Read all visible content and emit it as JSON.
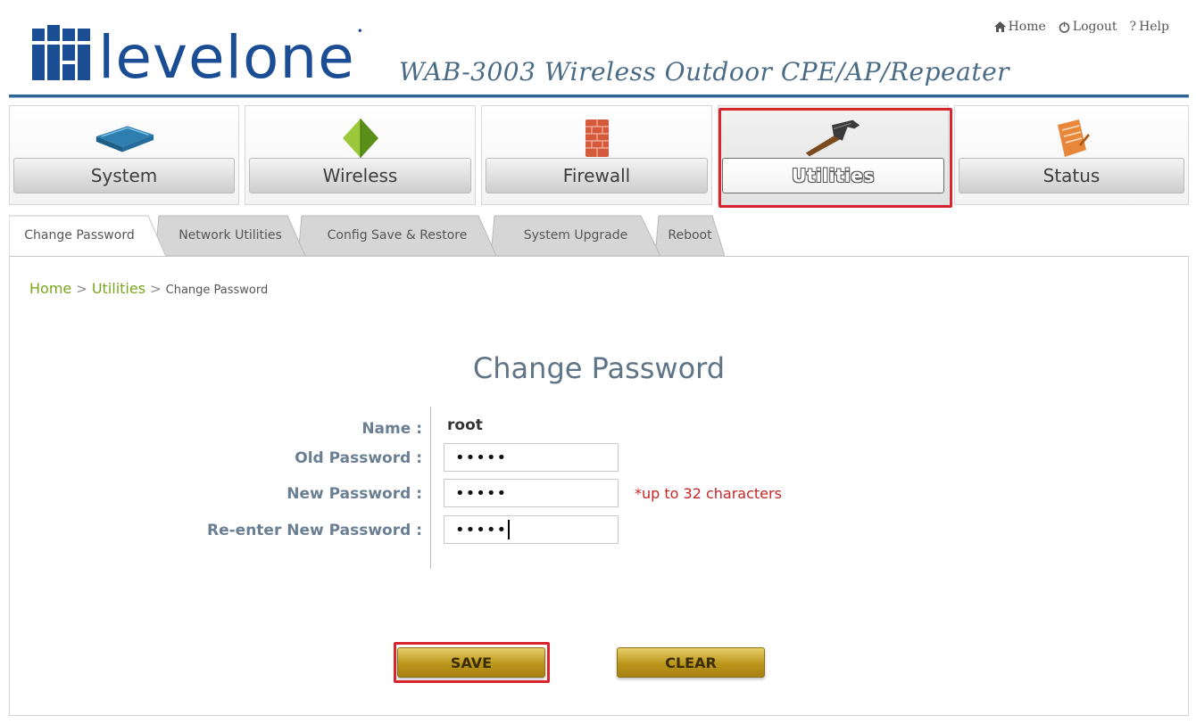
{
  "header": {
    "brand": "level",
    "brand_second": "one",
    "product": "WAB-3003 Wireless Outdoor CPE/AP/Repeater",
    "links": {
      "home": "Home",
      "logout": "Logout",
      "help": "Help"
    }
  },
  "nav": {
    "items": [
      {
        "label": "System",
        "icon": "router-icon"
      },
      {
        "label": "Wireless",
        "icon": "wireless-pyramid-icon"
      },
      {
        "label": "Firewall",
        "icon": "firewall-brick-icon"
      },
      {
        "label": "Utilities",
        "icon": "hammer-icon",
        "active": true
      },
      {
        "label": "Status",
        "icon": "notepad-icon"
      }
    ]
  },
  "subtabs": [
    {
      "label": "Change Password",
      "active": true
    },
    {
      "label": "Network Utilities"
    },
    {
      "label": "Config Save & Restore"
    },
    {
      "label": "System Upgrade"
    },
    {
      "label": "Reboot"
    }
  ],
  "breadcrumb": {
    "home": "Home",
    "section": "Utilities",
    "current": "Change Password",
    "sep": ">"
  },
  "form": {
    "title": "Change Password",
    "name_label": "Name :",
    "name_value": "root",
    "old_label": "Old Password :",
    "old_value": "•••••",
    "new_label": "New Password :",
    "new_value": "•••••",
    "hint": "*up to 32 characters",
    "reenter_label": "Re-enter New Password :",
    "reenter_value": "•••••"
  },
  "buttons": {
    "save": "SAVE",
    "clear": "CLEAR"
  },
  "colors": {
    "brand_blue": "#1a4d94",
    "highlight_red": "#d8242c",
    "link_green": "#7aa61d",
    "hint_red": "#c52626",
    "button_gold": "#bb951b"
  }
}
